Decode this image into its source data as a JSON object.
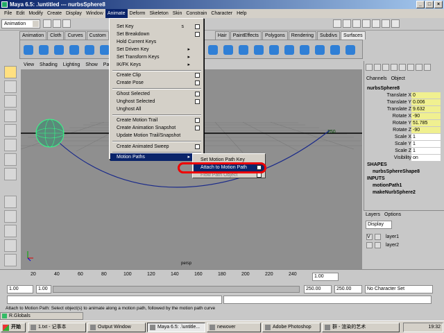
{
  "window": {
    "title": "Maya 6.5: .\\untitled   ---  nurbsSphere8",
    "min": "_",
    "max": "□",
    "close": "×"
  },
  "menubar": [
    "File",
    "Edit",
    "Modify",
    "Create",
    "Display",
    "Window",
    "Animate",
    "Deform",
    "Skeleton",
    "Skin",
    "Constrain",
    "Character",
    "Help"
  ],
  "status": {
    "mode": "Animation"
  },
  "shelf_tabs": [
    "Animation",
    "Cloth",
    "Curves",
    "Custom",
    "D",
    "Hair",
    "PaintEffects",
    "Polygons",
    "Rendering",
    "Subdivs",
    "Surfaces"
  ],
  "viewport": {
    "menu": [
      "View",
      "Shading",
      "Lighting",
      "Show",
      "Panels"
    ],
    "label": "persp",
    "frame_marker": "250"
  },
  "animate_menu": {
    "items": [
      {
        "label": "Set Key",
        "shortcut": "s",
        "option": true
      },
      {
        "label": "Set Breakdown",
        "option": true
      },
      {
        "label": "Hold Current Keys"
      },
      {
        "label": "Set Driven Key",
        "submenu": true
      },
      {
        "label": "Set Transform Keys",
        "submenu": true
      },
      {
        "label": "IK/FK Keys",
        "submenu": true
      },
      {
        "label": "Create Clip",
        "option": true
      },
      {
        "label": "Create Pose",
        "option": true
      },
      {
        "label": "Ghost Selected",
        "option": true
      },
      {
        "label": "Unghost Selected",
        "option": true
      },
      {
        "label": "Unghost All"
      },
      {
        "label": "Create Motion Trail",
        "option": true
      },
      {
        "label": "Create Animation Snapshot",
        "option": true
      },
      {
        "label": "Update Motion Trail/Snapshot"
      },
      {
        "label": "Create Animated Sweep",
        "option": true
      },
      {
        "label": "Motion Paths",
        "submenu": true,
        "highlighted": true
      }
    ]
  },
  "motion_paths_submenu": {
    "items": [
      {
        "label": "Set Motion Path Key"
      },
      {
        "label": "Attach to Motion Path",
        "option": true,
        "highlighted": true
      },
      {
        "label": "Flow Path Object",
        "option": true
      }
    ]
  },
  "channel_box": {
    "tabs": [
      "Channels",
      "Object"
    ],
    "object": "nurbsSphere8",
    "attributes": [
      {
        "name": "Translate X",
        "value": "0"
      },
      {
        "name": "Translate Y",
        "value": "0.006"
      },
      {
        "name": "Translate Z",
        "value": "9.632"
      },
      {
        "name": "Rotate X",
        "value": "-90"
      },
      {
        "name": "Rotate Y",
        "value": "51.785"
      },
      {
        "name": "Rotate Z",
        "value": "-90"
      },
      {
        "name": "Scale X",
        "value": "1"
      },
      {
        "name": "Scale Y",
        "value": "1"
      },
      {
        "name": "Scale Z",
        "value": "1"
      },
      {
        "name": "Visibility",
        "value": "on"
      }
    ],
    "shapes_header": "SHAPES",
    "shape": "nurbsSphereShape8",
    "inputs_header": "INPUTS",
    "inputs": [
      "motionPath1",
      "makeNurbSphere2"
    ]
  },
  "layers": {
    "tabs": [
      "Layers",
      "Options"
    ],
    "display": "Display",
    "rows": [
      {
        "v": "V",
        "name": "layer1"
      },
      {
        "v": "",
        "name": "layer2"
      }
    ]
  },
  "timeline": {
    "ticks": [
      "20",
      "40",
      "60",
      "80",
      "100",
      "120",
      "140",
      "160",
      "180",
      "200",
      "220",
      "240"
    ],
    "current": "1.00"
  },
  "range": {
    "start": "1.00",
    "start2": "1.00",
    "end": "250.00",
    "end2": "250.00",
    "character": "No Character Set"
  },
  "helpline": "Attach to Motion Path: Select object(s) to animate along a motion path, followed by the motion path curve",
  "mini_window": "R.Globals",
  "taskbar": {
    "start": "开始",
    "tasks": [
      "1.txt - 记事本",
      "Output Window",
      "Maya 6.5: .\\untitle...",
      "newover",
      "Adobe Photoshop",
      "群 - 渲染的艺术"
    ],
    "clock": "19:32"
  }
}
